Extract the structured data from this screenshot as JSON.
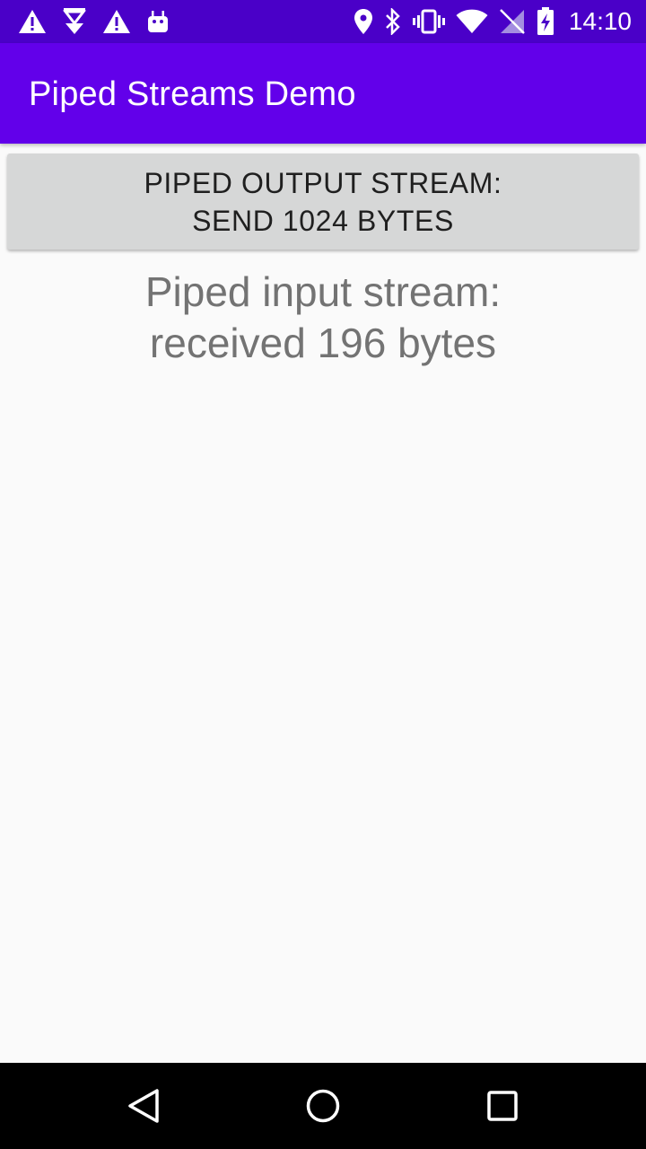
{
  "status_bar": {
    "time": "14:10",
    "left_icons": [
      "warning-icon",
      "download-icon",
      "warning-icon",
      "android-icon"
    ],
    "right_icons": [
      "location-icon",
      "bluetooth-icon",
      "vibrate-icon",
      "wifi-icon",
      "no-sim-icon",
      "battery-charging-icon"
    ],
    "background": "#4a00c8"
  },
  "app_bar": {
    "title": "Piped Streams Demo",
    "background": "#6200ea"
  },
  "main": {
    "send_button_label": "PIPED OUTPUT STREAM:\nSEND 1024 BYTES",
    "result_text": "Piped input stream:\nreceived 196 bytes"
  },
  "nav_bar": {
    "buttons": [
      "back-icon",
      "home-icon",
      "recents-icon"
    ]
  }
}
